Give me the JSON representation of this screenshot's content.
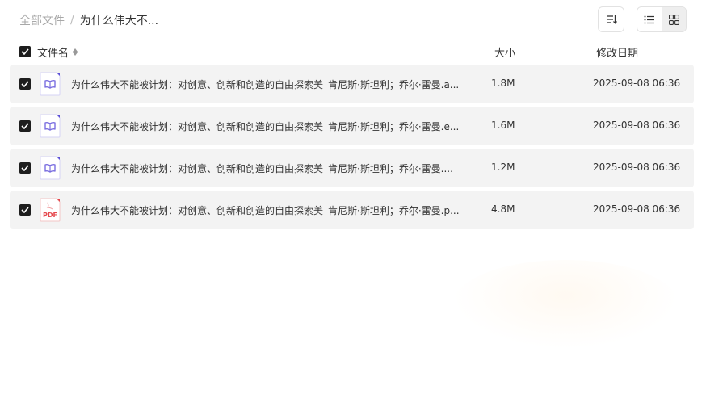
{
  "breadcrumb": {
    "root": "全部文件",
    "separator": "/",
    "current": "为什么伟大不..."
  },
  "toolbar": {
    "sort_icon": "sort-icon",
    "view_modes": [
      {
        "icon": "list-view-icon",
        "active": false
      },
      {
        "icon": "grid-view-icon",
        "active": true
      }
    ]
  },
  "columns": {
    "name": "文件名",
    "size": "大小",
    "modified": "修改日期"
  },
  "files": [
    {
      "icon": "ebook-icon",
      "name": "为什么伟大不能被计划：对创意、创新和创造的自由探索美_肯尼斯·斯坦利；乔尔·雷曼.a...",
      "size": "1.8M",
      "modified": "2025-09-08 06:36",
      "checked": true
    },
    {
      "icon": "ebook-icon",
      "name": "为什么伟大不能被计划：对创意、创新和创造的自由探索美_肯尼斯·斯坦利；乔尔·雷曼.e...",
      "size": "1.6M",
      "modified": "2025-09-08 06:36",
      "checked": true
    },
    {
      "icon": "ebook-icon",
      "name": "为什么伟大不能被计划：对创意、创新和创造的自由探索美_肯尼斯·斯坦利；乔尔·雷曼....",
      "size": "1.2M",
      "modified": "2025-09-08 06:36",
      "checked": true
    },
    {
      "icon": "pdf-icon",
      "icon_label": "PDF",
      "name": "为什么伟大不能被计划：对创意、创新和创造的自由探索美_肯尼斯·斯坦利；乔尔·雷曼.p...",
      "size": "4.8M",
      "modified": "2025-09-08 06:36",
      "checked": true
    }
  ],
  "colors": {
    "checkbox": "#1e1e1e",
    "row_bg": "#f3f3f3",
    "ebook_icon": "#7b6fe0",
    "pdf_icon": "#e5484d"
  }
}
